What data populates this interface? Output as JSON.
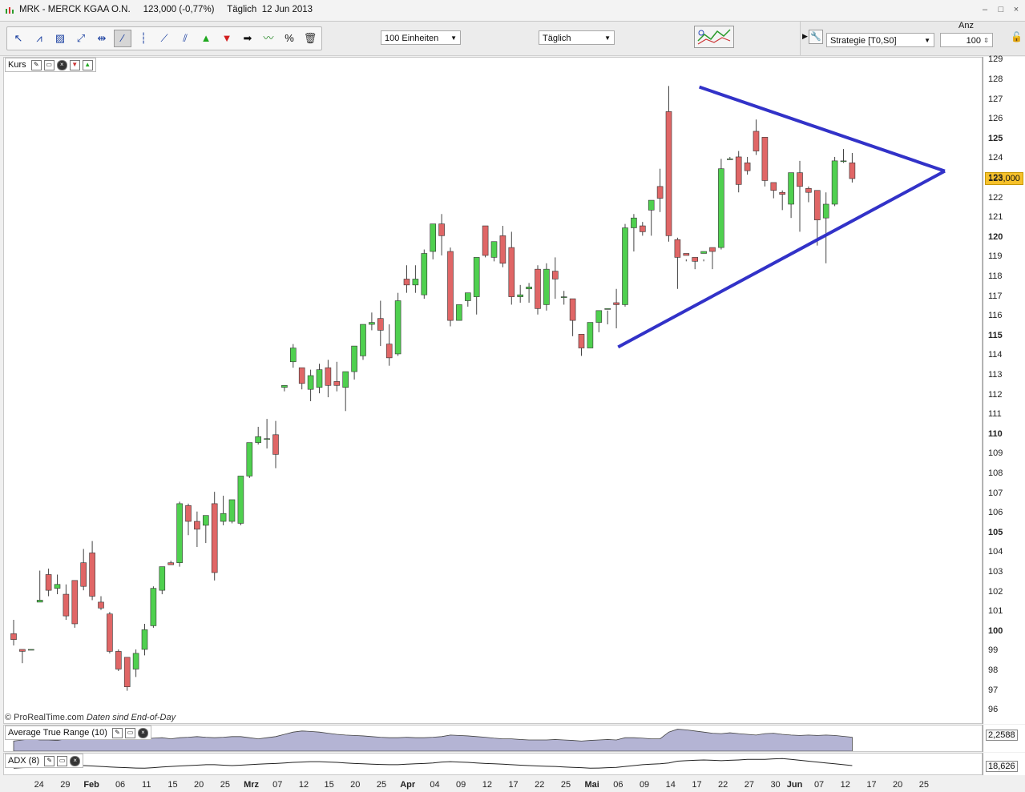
{
  "window": {
    "title": "MRK - MERCK KGAA O.N.     123,000 (-0,77%)     Täglich  12 Jun 2013",
    "buttons": [
      "–",
      "□",
      "×"
    ]
  },
  "toolbar": {
    "units": "100 Einheiten",
    "period": "Täglich",
    "strategy": "Strategie [T0,S0]",
    "qty_label": "Anz",
    "qty": "100",
    "tool_icons": [
      "cursor-icon",
      "trend-icon",
      "ruler-icon",
      "line-icon",
      "hline-icon",
      "segment-icon",
      "vline-icon",
      "ray-icon",
      "fib-icon",
      "buy-arrow-icon",
      "sell-arrow-icon",
      "right-arrow-icon",
      "wave-icon",
      "percent-icon",
      "trash-icon"
    ]
  },
  "price_panel": {
    "label": "Kurs",
    "last_price": "123,000",
    "credit_a": "© ProRealTime.com",
    "credit_b": "Daten sind End-of-Day"
  },
  "atr_panel": {
    "label": "Average True Range (10)",
    "value": "2,2588"
  },
  "adx_panel": {
    "label": "ADX (8)",
    "value": "18,626"
  },
  "colors": {
    "up": "#4fd04f",
    "down": "#e06666",
    "triangle": "#3232c8",
    "last": "#f6c12a"
  },
  "chart_data": {
    "type": "candlestick",
    "y_ticks": [
      "129",
      "128",
      "127",
      "126",
      "125",
      "124",
      "123",
      "122",
      "121",
      "120",
      "119",
      "118",
      "117",
      "116",
      "115",
      "114",
      "113",
      "112",
      "111",
      "110",
      "109",
      "108",
      "107",
      "106",
      "105",
      "104",
      "103",
      "102",
      "101",
      "100",
      "99",
      "98",
      "97",
      "96"
    ],
    "y_major": [
      "125",
      "120",
      "115",
      "110",
      "105",
      "100"
    ],
    "ylim": [
      95.5,
      129.5
    ],
    "x_ticks": [
      "24",
      "29",
      "Feb",
      "06",
      "11",
      "15",
      "20",
      "25",
      "Mrz",
      "07",
      "12",
      "15",
      "20",
      "25",
      "Apr",
      "04",
      "09",
      "12",
      "17",
      "22",
      "25",
      "Mai",
      "06",
      "09",
      "14",
      "17",
      "22",
      "27",
      "30",
      "Jun",
      "07",
      "12",
      "17",
      "20",
      "25"
    ],
    "x_months": [
      "Feb",
      "Mrz",
      "Apr",
      "Mai",
      "Jun"
    ],
    "candles": [
      [
        99.9,
        100.6,
        99.6,
        99.3
      ],
      [
        99.1,
        99.1,
        99.0,
        98.4
      ],
      [
        99.1,
        101.8,
        99.1,
        101.8
      ],
      [
        101.5,
        103.1,
        101.6,
        101.5
      ],
      [
        102.9,
        103.2,
        102.1,
        101.8
      ],
      [
        102.2,
        102.9,
        102.4,
        101.9
      ],
      [
        101.9,
        102.4,
        100.8,
        100.6
      ],
      [
        102.6,
        102.3,
        100.4,
        100.2
      ],
      [
        103.5,
        104.2,
        102.3,
        102.1
      ],
      [
        104.0,
        104.6,
        101.8,
        101.6
      ],
      [
        101.5,
        101.8,
        101.2,
        101.1
      ],
      [
        100.9,
        101.0,
        99.0,
        98.9
      ],
      [
        99.0,
        99.1,
        98.1,
        98.0
      ],
      [
        98.7,
        98.7,
        97.2,
        97.0
      ],
      [
        98.1,
        99.1,
        98.9,
        97.7
      ],
      [
        99.1,
        100.4,
        100.1,
        98.8
      ],
      [
        100.3,
        102.3,
        102.2,
        100.2
      ],
      [
        102.1,
        103.3,
        103.3,
        101.9
      ],
      [
        103.5,
        103.6,
        103.4,
        103.4
      ],
      [
        103.5,
        106.6,
        106.5,
        103.3
      ],
      [
        106.4,
        106.5,
        105.6,
        104.9
      ],
      [
        105.6,
        106.1,
        105.2,
        104.3
      ],
      [
        105.4,
        105.8,
        105.9,
        104.5
      ],
      [
        106.5,
        107.1,
        103.0,
        102.6
      ],
      [
        105.6,
        106.9,
        106.0,
        105.4
      ],
      [
        105.6,
        106.2,
        106.7,
        105.5
      ],
      [
        105.5,
        107.9,
        107.9,
        105.4
      ],
      [
        107.9,
        109.2,
        109.6,
        107.8
      ],
      [
        109.6,
        110.4,
        109.9,
        109.5
      ],
      [
        109.8,
        110.8,
        109.8,
        109.3
      ],
      [
        110.0,
        110.7,
        109.0,
        108.3
      ],
      [
        112.4,
        112.5,
        112.5,
        112.2
      ],
      [
        113.7,
        114.6,
        114.4,
        113.4
      ],
      [
        113.4,
        113.4,
        112.6,
        112.3
      ],
      [
        112.3,
        113.3,
        113.0,
        111.7
      ],
      [
        112.4,
        113.6,
        113.3,
        112.1
      ],
      [
        113.4,
        113.8,
        112.5,
        111.9
      ],
      [
        112.7,
        113.7,
        112.5,
        112.2
      ],
      [
        112.4,
        113.2,
        113.2,
        111.2
      ],
      [
        113.2,
        114.4,
        114.5,
        112.8
      ],
      [
        114.0,
        115.0,
        115.6,
        113.8
      ],
      [
        115.6,
        116.2,
        115.7,
        115.3
      ],
      [
        115.9,
        116.8,
        115.3,
        114.5
      ],
      [
        114.6,
        115.6,
        113.9,
        113.5
      ],
      [
        114.1,
        117.2,
        116.8,
        114.0
      ],
      [
        117.9,
        118.6,
        117.6,
        117.2
      ],
      [
        117.6,
        118.6,
        117.9,
        117.2
      ],
      [
        117.1,
        119.4,
        119.2,
        116.9
      ],
      [
        119.3,
        120.4,
        120.7,
        118.9
      ],
      [
        120.7,
        121.2,
        120.1,
        119.1
      ],
      [
        119.3,
        119.5,
        115.8,
        115.5
      ],
      [
        115.8,
        116.2,
        116.6,
        115.8
      ],
      [
        116.8,
        117.2,
        117.2,
        116.5
      ],
      [
        117.0,
        118.8,
        119.0,
        116.1
      ],
      [
        120.6,
        120.6,
        119.1,
        119.0
      ],
      [
        119.0,
        119.8,
        119.8,
        118.8
      ],
      [
        120.1,
        120.6,
        118.7,
        118.5
      ],
      [
        119.5,
        120.3,
        117.0,
        116.6
      ],
      [
        117.0,
        117.6,
        117.1,
        116.7
      ],
      [
        117.4,
        117.7,
        117.5,
        116.7
      ],
      [
        118.4,
        118.6,
        116.4,
        116.1
      ],
      [
        116.6,
        118.7,
        118.4,
        116.3
      ],
      [
        118.3,
        119.0,
        117.9,
        116.9
      ],
      [
        117.0,
        117.3,
        117.0,
        116.6
      ],
      [
        116.9,
        116.8,
        115.8,
        115.0
      ],
      [
        115.1,
        115.1,
        114.4,
        114.0
      ],
      [
        114.4,
        115.6,
        115.7,
        114.4
      ],
      [
        115.7,
        116.2,
        116.3,
        115.2
      ],
      [
        116.4,
        116.3,
        116.4,
        115.6
      ],
      [
        116.7,
        117.4,
        116.6,
        115.4
      ],
      [
        116.6,
        120.7,
        120.5,
        116.5
      ],
      [
        120.5,
        121.2,
        121.0,
        119.3
      ],
      [
        120.6,
        120.8,
        120.3,
        120.1
      ],
      [
        121.4,
        121.4,
        121.9,
        120.1
      ],
      [
        122.6,
        123.5,
        122.0,
        121.3
      ],
      [
        126.4,
        127.7,
        120.1,
        119.8
      ],
      [
        119.9,
        120.0,
        119.0,
        117.4
      ],
      [
        119.2,
        118.9,
        119.1,
        118.8
      ],
      [
        119.0,
        118.9,
        118.8,
        118.4
      ],
      [
        119.2,
        118.9,
        119.3,
        118.8
      ],
      [
        119.5,
        119.5,
        119.3,
        118.4
      ],
      [
        119.5,
        124.0,
        123.5,
        119.4
      ],
      [
        124.0,
        124.0,
        124.0,
        124.1
      ],
      [
        124.1,
        124.4,
        122.7,
        122.3
      ],
      [
        123.8,
        124.1,
        123.4,
        123.2
      ],
      [
        125.4,
        126.0,
        124.4,
        124.2
      ],
      [
        125.1,
        125.0,
        122.9,
        122.6
      ],
      [
        122.8,
        122.7,
        122.4,
        122.0
      ],
      [
        122.3,
        122.4,
        122.2,
        121.4
      ],
      [
        121.7,
        121.7,
        123.3,
        121.0
      ],
      [
        123.3,
        123.9,
        122.6,
        120.3
      ],
      [
        122.5,
        122.6,
        122.3,
        121.8
      ],
      [
        122.4,
        122.4,
        120.9,
        119.6
      ],
      [
        121.0,
        122.3,
        121.7,
        118.7
      ],
      [
        121.7,
        124.1,
        123.9,
        121.6
      ],
      [
        123.9,
        124.5,
        123.9,
        123.8
      ],
      [
        123.8,
        124.3,
        123.0,
        122.8
      ]
    ],
    "triangle": {
      "upper": [
        [
          127.65,
          "14 Mai"
        ],
        [
          123.38,
          "21 Jun"
        ]
      ],
      "lower": [
        [
          114.45,
          "Mai 02"
        ],
        [
          123.38,
          "21 Jun"
        ]
      ]
    },
    "atr": [
      0.45,
      0.5,
      0.55,
      0.5,
      0.5,
      0.48,
      0.55,
      0.6,
      0.6,
      0.55,
      0.58,
      0.6,
      0.62,
      0.62,
      0.55,
      0.55,
      0.58,
      0.6,
      0.55,
      0.6,
      0.62,
      0.65,
      0.62,
      0.6,
      0.62,
      0.65,
      0.65,
      0.6,
      0.55,
      0.6,
      0.65,
      0.75,
      0.85,
      0.9,
      0.88,
      0.85,
      0.8,
      0.75,
      0.72,
      0.7,
      0.68,
      0.65,
      0.62,
      0.6,
      0.6,
      0.62,
      0.6,
      0.6,
      0.62,
      0.65,
      0.72,
      0.7,
      0.68,
      0.65,
      0.62,
      0.58,
      0.55,
      0.55,
      0.52,
      0.5,
      0.5,
      0.5,
      0.52,
      0.5,
      0.48,
      0.45,
      0.48,
      0.5,
      0.52,
      0.5,
      0.6,
      0.6,
      0.58,
      0.55,
      0.55,
      0.85,
      0.98,
      0.95,
      0.9,
      0.85,
      0.8,
      0.78,
      0.82,
      0.78,
      0.75,
      0.72,
      0.78,
      0.8,
      0.75,
      0.72,
      0.7,
      0.72,
      0.7,
      0.72,
      0.7,
      0.66,
      0.62
    ],
    "adx": [
      0.35,
      0.38,
      0.4,
      0.42,
      0.45,
      0.48,
      0.5,
      0.52,
      0.5,
      0.48,
      0.45,
      0.42,
      0.4,
      0.38,
      0.36,
      0.35,
      0.38,
      0.42,
      0.45,
      0.48,
      0.5,
      0.52,
      0.55,
      0.55,
      0.52,
      0.5,
      0.52,
      0.55,
      0.58,
      0.6,
      0.62,
      0.65,
      0.68,
      0.7,
      0.72,
      0.72,
      0.7,
      0.68,
      0.65,
      0.62,
      0.6,
      0.58,
      0.56,
      0.55,
      0.55,
      0.58,
      0.6,
      0.62,
      0.65,
      0.7,
      0.72,
      0.7,
      0.68,
      0.65,
      0.62,
      0.6,
      0.58,
      0.55,
      0.52,
      0.5,
      0.48,
      0.46,
      0.45,
      0.42,
      0.4,
      0.38,
      0.35,
      0.36,
      0.38,
      0.4,
      0.45,
      0.5,
      0.55,
      0.58,
      0.6,
      0.65,
      0.75,
      0.78,
      0.8,
      0.82,
      0.8,
      0.78,
      0.8,
      0.82,
      0.85,
      0.85,
      0.85,
      0.88,
      0.9,
      0.85,
      0.8,
      0.75,
      0.7,
      0.65,
      0.6,
      0.55,
      0.5
    ]
  }
}
